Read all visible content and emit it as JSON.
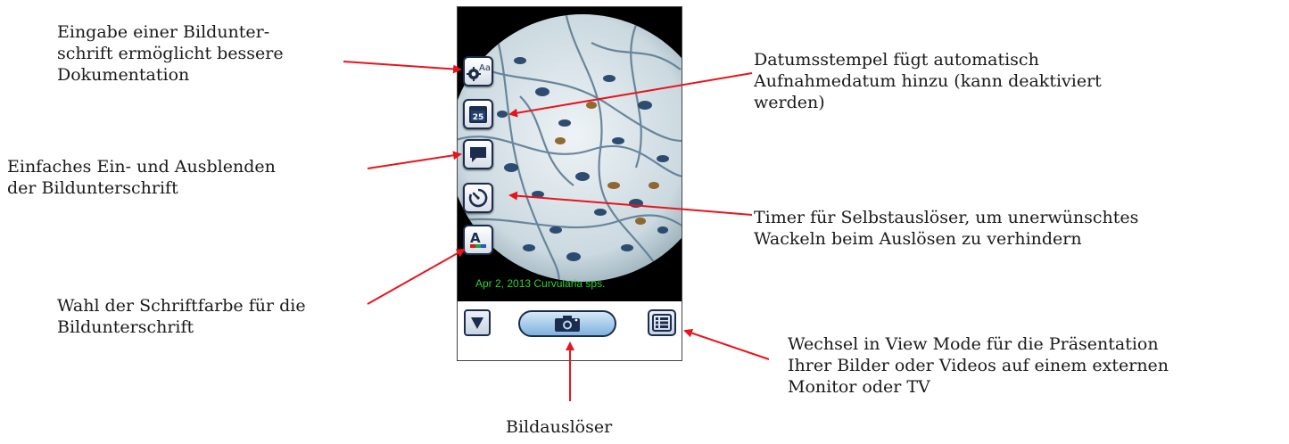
{
  "annotations": {
    "caption_input": [
      "Eingabe einer Bildunter-",
      "schrift ermöglicht bessere",
      "Dokumentation"
    ],
    "date_stamp": [
      "Datumsstempel fügt automatisch",
      "Aufnahmedatum hinzu (kann deaktiviert",
      "werden)"
    ],
    "toggle_caption": [
      "Einfaches Ein- und Ausblenden",
      "der Bildunterschrift"
    ],
    "timer": [
      "Timer für Selbstauslöser, um unerwünschtes",
      "Wackeln beim Auslösen zu verhindern"
    ],
    "font_color": [
      "Wahl der Schriftfarbe für die",
      "Bildunterschrift"
    ],
    "view_mode": [
      "Wechsel in View Mode für die Präsentation",
      "Ihrer Bilder oder Videos auf einem externen",
      "Monitor oder TV"
    ],
    "shutter": [
      "Bildauslöser"
    ]
  },
  "app": {
    "caption_overlay": "Apr 2, 2013 Curvularia sps.",
    "date_icon_number": "25",
    "font_color_icon_letter": "A",
    "caption_icon_text": "Aa"
  },
  "colors": {
    "arrow": "#e8141c",
    "button_border": "#1b2d4f",
    "caption_green": "#2fd12f",
    "shutter_blue": "#7fb2dd"
  },
  "icons": {
    "caption_button": "caption-settings-icon",
    "date_button": "calendar-icon",
    "toggle_button": "speech-bubble-icon",
    "timer_button": "timer-icon",
    "font_color_button": "font-color-icon",
    "hide_bar": "triangle-down-icon",
    "shutter": "camera-icon",
    "view_mode": "list-icon"
  }
}
